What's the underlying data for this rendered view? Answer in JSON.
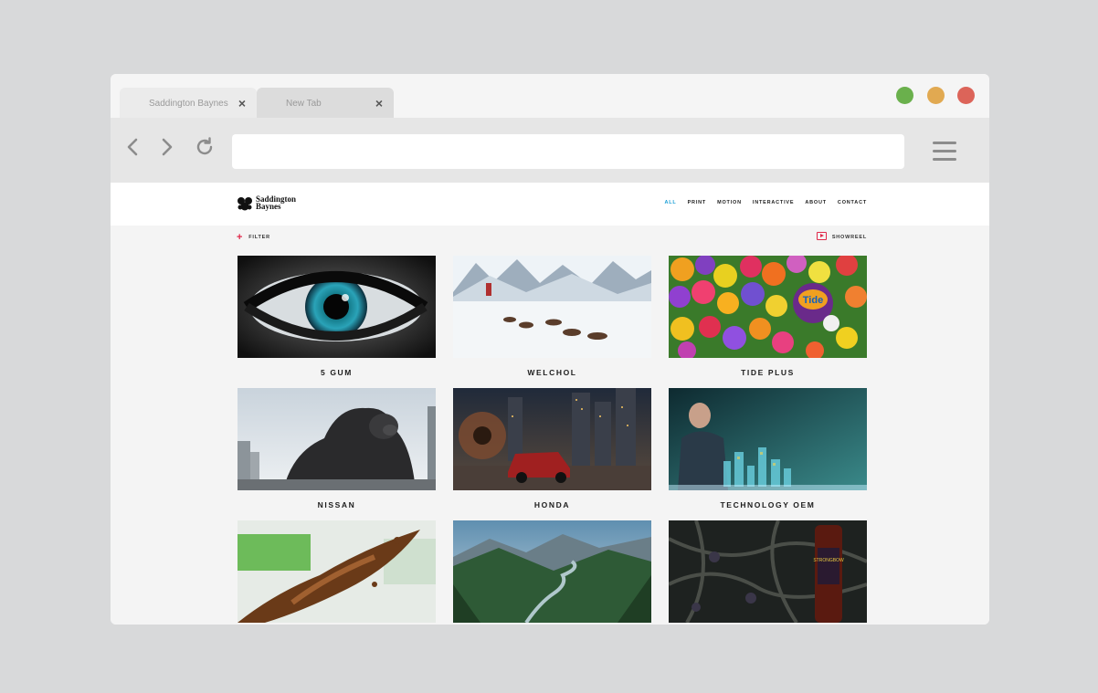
{
  "browser": {
    "tabs": [
      {
        "label": "Saddington Baynes",
        "close": "×"
      },
      {
        "label": "New Tab",
        "close": "×"
      }
    ],
    "address_value": "",
    "colors": {
      "close_green": "#6ab04c",
      "min_yellow": "#e1a951",
      "max_red": "#dc6459"
    }
  },
  "site": {
    "logo_line1": "Saddington",
    "logo_line2": "Baynes",
    "nav": [
      "ALL",
      "PRINT",
      "MOTION",
      "INTERACTIVE",
      "ABOUT",
      "CONTACT"
    ],
    "active_nav": "ALL",
    "filter_label": "FILTER",
    "showreel_label": "SHOWREEL",
    "accent_color": "#e0284a",
    "active_color": "#1a9fd6",
    "projects": [
      {
        "title": "5 GUM",
        "icon": "eye-image"
      },
      {
        "title": "WELCHOL",
        "icon": "sled-dogs-image"
      },
      {
        "title": "TIDE PLUS",
        "icon": "flowers-image"
      },
      {
        "title": "NISSAN",
        "icon": "gorilla-image"
      },
      {
        "title": "HONDA",
        "icon": "car-city-image"
      },
      {
        "title": "TECHNOLOGY OEM",
        "icon": "holographic-city-image"
      },
      {
        "title": "",
        "icon": "liquid-splash-image"
      },
      {
        "title": "",
        "icon": "valley-river-image"
      },
      {
        "title": "",
        "icon": "cider-bottle-thorns-image"
      }
    ]
  }
}
